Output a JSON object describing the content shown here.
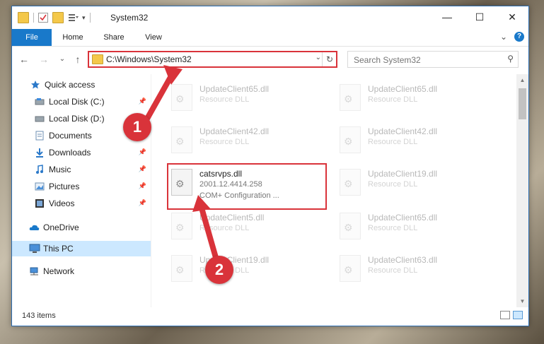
{
  "titlebar": {
    "title": "System32",
    "minimize_label": "—",
    "maximize_label": "☐",
    "close_label": "✕"
  },
  "ribbon": {
    "tabs": [
      {
        "label": "File"
      },
      {
        "label": "Home"
      },
      {
        "label": "Share"
      },
      {
        "label": "View"
      }
    ],
    "collapse_label": "⌄",
    "help_label": "?"
  },
  "navbar": {
    "back_label": "←",
    "forward_label": "→",
    "recent_label": "⌄",
    "up_label": "↑",
    "address": "C:\\Windows\\System32",
    "address_dropdown": "⌄",
    "refresh_label": "↻",
    "search_placeholder": "Search System32",
    "search_icon_label": "⚲"
  },
  "sidebar": {
    "items": [
      {
        "label": "Quick access",
        "icon": "star-icon",
        "pinned": false
      },
      {
        "label": "Local Disk (C:)",
        "icon": "drive-icon",
        "pinned": true
      },
      {
        "label": "Local Disk (D:)",
        "icon": "drive-icon",
        "pinned": false
      },
      {
        "label": "Documents",
        "icon": "documents-icon",
        "pinned": true
      },
      {
        "label": "Downloads",
        "icon": "download-icon",
        "pinned": true
      },
      {
        "label": "Music",
        "icon": "music-icon",
        "pinned": true
      },
      {
        "label": "Pictures",
        "icon": "pictures-icon",
        "pinned": true
      },
      {
        "label": "Videos",
        "icon": "videos-icon",
        "pinned": true
      },
      {
        "label": "OneDrive",
        "icon": "cloud-icon",
        "pinned": false
      },
      {
        "label": "This PC",
        "icon": "computer-icon",
        "pinned": false,
        "selected": true
      },
      {
        "label": "Network",
        "icon": "network-icon",
        "pinned": false
      }
    ],
    "pin_glyph": "📌"
  },
  "files": {
    "left": [
      {
        "name": "UpdateClient65.dll",
        "type": "Resource DLL"
      },
      {
        "name": "UpdateClient42.dll",
        "type": "Resource DLL"
      },
      {
        "name": "catsrvps.dll",
        "version": "2001.12.4414.258",
        "type": "COM+ Configuration ...",
        "highlighted": true
      },
      {
        "name": "UpdateClient5.dll",
        "type": "Resource DLL"
      },
      {
        "name": "UpdateClient19.dll",
        "type": "Resource DLL"
      }
    ],
    "right": [
      {
        "name": "UpdateClient65.dll",
        "type": "Resource DLL"
      },
      {
        "name": "UpdateClient42.dll",
        "type": "Resource DLL"
      },
      {
        "name": "UpdateClient19.dll",
        "type": "Resource DLL"
      },
      {
        "name": "UpdateClient65.dll",
        "type": "Resource DLL"
      },
      {
        "name": "UpdateClient63.dll",
        "type": "Resource DLL"
      }
    ]
  },
  "status": {
    "item_count": "143 items"
  },
  "callouts": {
    "step1": "1",
    "step2": "2"
  },
  "colors": {
    "accent": "#1979ca",
    "highlight": "#d9333a",
    "selected": "#cce8ff"
  }
}
